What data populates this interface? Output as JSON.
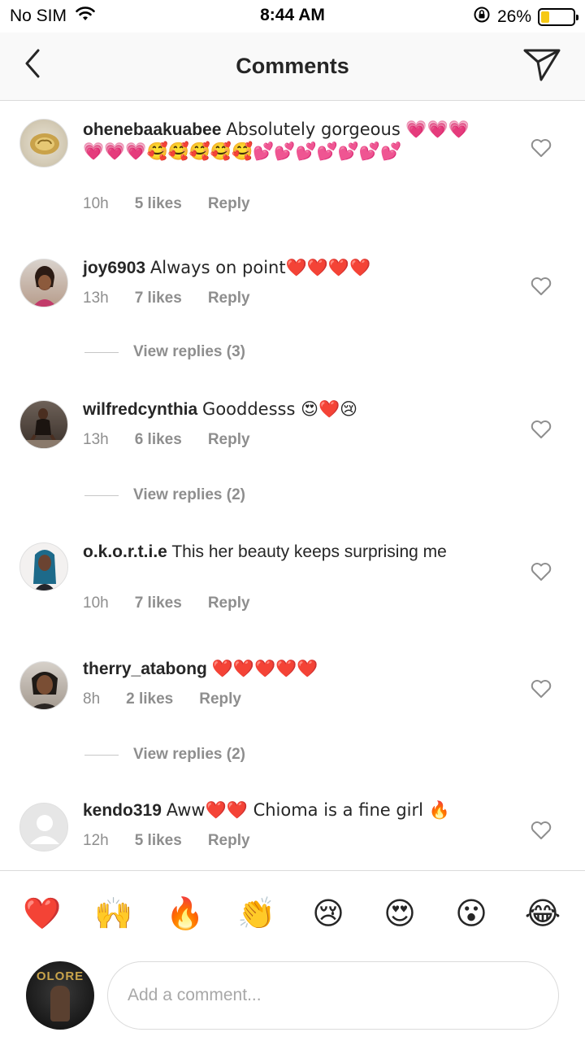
{
  "status_bar": {
    "carrier": "No SIM",
    "time": "8:44 AM",
    "battery_percent": "26%",
    "battery_level": 0.26,
    "battery_color": "#f6c915"
  },
  "header": {
    "title": "Comments",
    "back_icon": "chevron-left-icon",
    "send_icon": "paper-plane-icon"
  },
  "comments": [
    {
      "username": "ohenebaakuabee",
      "text": "Absolutely gorgeous 💗💗💗💗💗💗🥰🥰🥰🥰🥰💕💕💕💕💕💕💕",
      "time": "10h",
      "likes": "5 likes",
      "reply": "Reply"
    },
    {
      "username": "joy6903",
      "text": "Always on point❤️❤️❤️❤️",
      "time": "13h",
      "likes": "7 likes",
      "reply": "Reply",
      "view_replies": "View replies (3)"
    },
    {
      "username": "wilfredcynthia",
      "text": "Gooddesss 😍❤️😢",
      "time": "13h",
      "likes": "6 likes",
      "reply": "Reply",
      "view_replies": "View replies (2)"
    },
    {
      "username": "o.k.o.r.t.i.e",
      "text": "This her beauty keeps surprising me",
      "time": "10h",
      "likes": "7 likes",
      "reply": "Reply"
    },
    {
      "username": "therry_atabong",
      "text": "❤️❤️❤️❤️❤️",
      "time": "8h",
      "likes": "2 likes",
      "reply": "Reply",
      "view_replies": "View replies (2)"
    },
    {
      "username": "kendo319",
      "text": "Aww❤️❤️ Chioma is a fine girl 🔥",
      "time": "12h",
      "likes": "5 likes",
      "reply": "Reply"
    }
  ],
  "emoji_bar": [
    "❤️",
    "🙌",
    "🔥",
    "👏",
    "😢",
    "😍",
    "😮",
    "😂"
  ],
  "composer": {
    "placeholder": "Add a comment...",
    "avatar_text": "OLORE"
  }
}
